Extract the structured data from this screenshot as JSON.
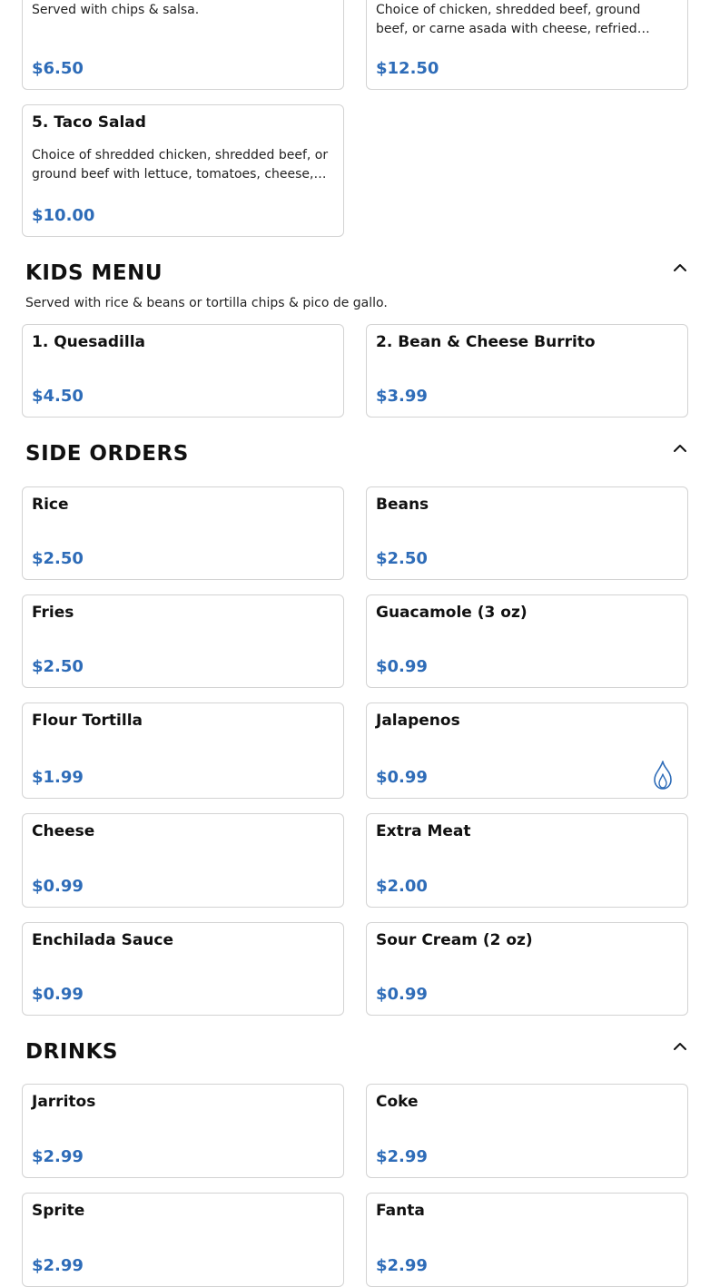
{
  "appetizer_cards": [
    {
      "desc": "Served with chips & salsa.",
      "price": "$6.50"
    },
    {
      "desc": "Choice of chicken, shredded beef, ground beef, or carne asada with cheese, refried beans, and sour cream.",
      "price": "$12.50"
    },
    {
      "name": "5. Taco Salad",
      "desc": "Choice of shredded chicken, shredded beef, or ground beef with lettuce, tomatoes, cheese, sour cream and guacamole.",
      "price": "$10.00"
    }
  ],
  "kids_menu": {
    "title": "KIDS MENU",
    "subtitle": "Served with rice & beans or tortilla chips & pico de gallo.",
    "items": [
      {
        "name": "1. Quesadilla",
        "price": "$4.50"
      },
      {
        "name": "2. Bean & Cheese Burrito",
        "price": "$3.99"
      }
    ]
  },
  "side_orders": {
    "title": "SIDE ORDERS",
    "items": [
      {
        "name": "Rice",
        "price": "$2.50"
      },
      {
        "name": "Beans",
        "price": "$2.50"
      },
      {
        "name": "Fries",
        "price": "$2.50"
      },
      {
        "name": "Guacamole (3 oz)",
        "price": "$0.99"
      },
      {
        "name": "Flour Tortilla",
        "price": "$1.99"
      },
      {
        "name": "Jalapenos",
        "price": "$0.99",
        "icon": "flame-icon"
      },
      {
        "name": "Cheese",
        "price": "$0.99"
      },
      {
        "name": "Extra Meat",
        "price": "$2.00"
      },
      {
        "name": "Enchilada Sauce",
        "price": "$0.99"
      },
      {
        "name": "Sour Cream (2 oz)",
        "price": "$0.99"
      }
    ]
  },
  "drinks": {
    "title": "DRINKS",
    "items": [
      {
        "name": "Jarritos",
        "price": "$2.99"
      },
      {
        "name": "Coke",
        "price": "$2.99"
      },
      {
        "name": "Sprite",
        "price": "$2.99"
      },
      {
        "name": "Fanta",
        "price": "$2.99"
      }
    ]
  },
  "icons": {
    "collapse": "chevron-up-icon",
    "spicy": "flame-icon"
  },
  "colors": {
    "price": "#2e6cb8",
    "card_border": "#d3d3d3",
    "text": "#111111"
  }
}
